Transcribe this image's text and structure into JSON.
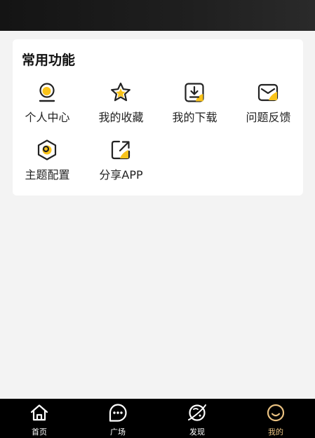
{
  "section": {
    "title": "常用功能",
    "items": [
      {
        "label": "个人中心",
        "icon": "person-center-icon"
      },
      {
        "label": "我的收藏",
        "icon": "star-icon"
      },
      {
        "label": "我的下载",
        "icon": "download-icon"
      },
      {
        "label": "问题反馈",
        "icon": "mail-icon"
      },
      {
        "label": "主题配置",
        "icon": "theme-hexagon-icon"
      },
      {
        "label": "分享APP",
        "icon": "share-icon"
      }
    ]
  },
  "tabbar": {
    "items": [
      {
        "label": "首页",
        "icon": "home-icon"
      },
      {
        "label": "广场",
        "icon": "chat-bubble-icon"
      },
      {
        "label": "发现",
        "icon": "planet-icon"
      },
      {
        "label": "我的",
        "icon": "smile-icon",
        "active": true
      }
    ]
  },
  "colors": {
    "accent_yellow": "#f9c31a",
    "icon_dark": "#222222",
    "tab_active": "#e9c181",
    "header_bg": "#1c1c1c",
    "tabbar_bg": "#000000"
  }
}
